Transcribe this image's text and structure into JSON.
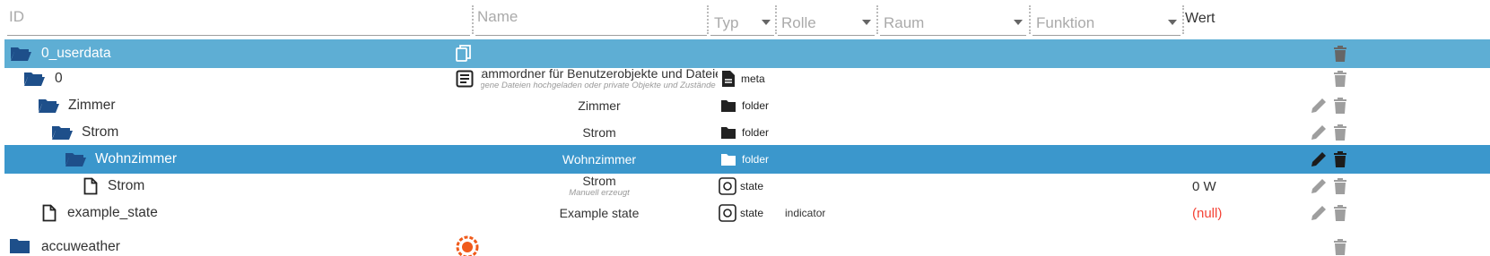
{
  "filters": {
    "id_placeholder": "ID",
    "name_placeholder": "Name",
    "typ_label": "Typ",
    "rolle_label": "Rolle",
    "raum_label": "Raum",
    "funktion_label": "Funktion",
    "wert_header": "Wert"
  },
  "rows": [
    {
      "id": "0_userdata",
      "name": "",
      "subtitle": "",
      "typ_icon": "",
      "role": "",
      "room": "",
      "value": "",
      "icon": "folder-open-icon"
    },
    {
      "id": "0",
      "name": "Stammordner für Benutzerobjekte und Dateien",
      "subtitle": "Hier können eigene Dateien hochgeladen oder private Objekte und Zustände erstellt werden",
      "typ_icon": "file-icon",
      "role": "meta",
      "room": "",
      "value": "",
      "icon": "folder-open-icon"
    },
    {
      "id": "Zimmer",
      "name": "Zimmer",
      "subtitle": "",
      "typ_icon": "folder-icon",
      "role": "folder",
      "room": "",
      "value": "",
      "icon": "folder-open-icon"
    },
    {
      "id": "Strom",
      "name": "Strom",
      "subtitle": "",
      "typ_icon": "folder-icon",
      "role": "folder",
      "room": "",
      "value": "",
      "icon": "folder-open-icon"
    },
    {
      "id": "Wohnzimmer",
      "name": "Wohnzimmer",
      "subtitle": "",
      "typ_icon": "folder-icon",
      "role": "folder",
      "room": "",
      "value": "",
      "icon": "folder-open-icon"
    },
    {
      "id": "Strom",
      "name": "Strom",
      "subtitle": "Manuell erzeugt",
      "typ_icon": "state-icon",
      "role": "state",
      "room": "",
      "value": "0 W",
      "icon": "file-icon"
    },
    {
      "id": "example_state",
      "name": "Example state",
      "subtitle": "",
      "typ_icon": "state-icon",
      "role": "state",
      "room": "indicator",
      "value": "(null)",
      "icon": "file-icon"
    },
    {
      "id": "accuweather",
      "name": "",
      "subtitle": "",
      "typ_icon": "",
      "role": "",
      "room": "",
      "value": "",
      "icon": "folder-icon"
    }
  ],
  "colors": {
    "selected_light": "#5eaed4",
    "selected_dark": "#3b97cc",
    "folder_icon": "#1e4f8a",
    "null_value": "#f44336",
    "action_icon": "#9e9e9e"
  }
}
